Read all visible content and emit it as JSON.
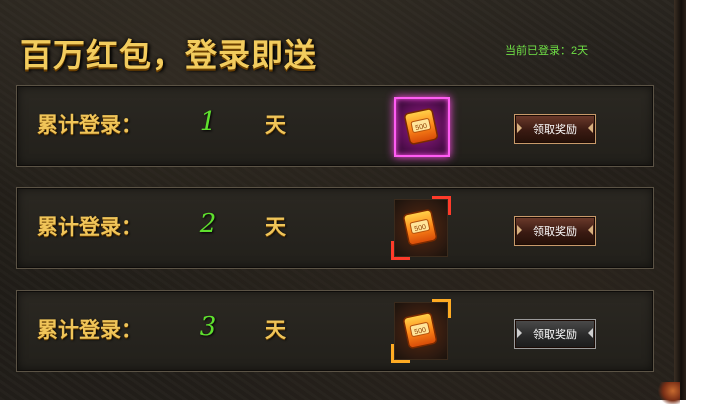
{
  "title": "百万红包，登录即送",
  "login_status": "当前已登录：2天",
  "rows": [
    {
      "label": "累计登录：",
      "day": "1",
      "unit": "天",
      "bag_text": "500",
      "button": "领取奖励",
      "frame_style": "magenta-glow",
      "button_state": "active"
    },
    {
      "label": "累计登录：",
      "day": "2",
      "unit": "天",
      "bag_text": "500",
      "button": "领取奖励",
      "frame_style": "orange-red-corners",
      "button_state": "active"
    },
    {
      "label": "累计登录：",
      "day": "3",
      "unit": "天",
      "bag_text": "500",
      "button": "领取奖励",
      "frame_style": "orange-gold-corners",
      "button_state": "disabled"
    }
  ],
  "colors": {
    "title": "#f2cc5e",
    "label": "#f0c559",
    "day_number": "#5fe02e",
    "status_text": "#6fe046",
    "magenta_glow": "#ff5cf3",
    "red_corner": "#ff3b2a",
    "gold_corner": "#ffab23"
  },
  "icons": {
    "reward": "red-envelope-bag-icon"
  }
}
